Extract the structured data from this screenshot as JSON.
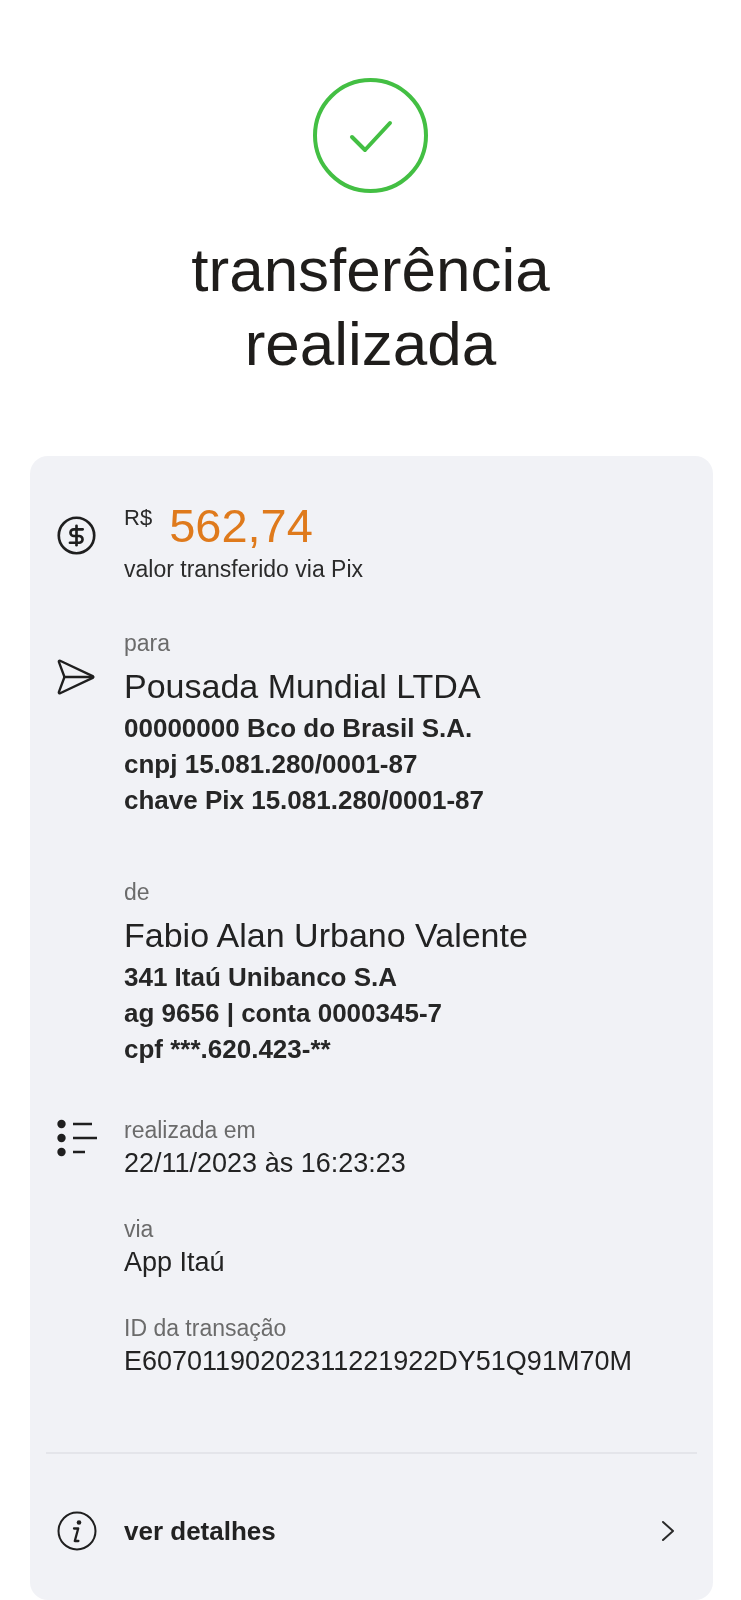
{
  "header": {
    "title": "transferência realizada"
  },
  "receipt": {
    "entries": [
      {
        "kind": "amount",
        "currency": "R$",
        "value": "562,74",
        "caption": "valor transferido via Pix"
      },
      {
        "kind": "recipient",
        "label": "para",
        "name": "Pousada Mundial LTDA",
        "details": [
          "00000000 Bco do Brasil S.A.",
          "cnpj 15.081.280/0001-87",
          "chave Pix 15.081.280/0001-87"
        ]
      },
      {
        "kind": "sender",
        "label": "de",
        "name": "Fabio Alan Urbano Valente",
        "details": [
          "341 Itaú Unibanco S.A",
          "ag 9656 | conta 0000345-7",
          "cpf ***.620.423-**"
        ]
      },
      {
        "kind": "date",
        "label": "realizada em",
        "value": "22/11/2023 às 16:23:23"
      },
      {
        "kind": "channel",
        "label": "via",
        "value": "App Itaú"
      },
      {
        "kind": "transaction_id",
        "label": "ID da transação",
        "value": "E60701190202311221922DY51Q91M70M"
      }
    ],
    "details_link": {
      "label": "ver detalhes"
    }
  }
}
